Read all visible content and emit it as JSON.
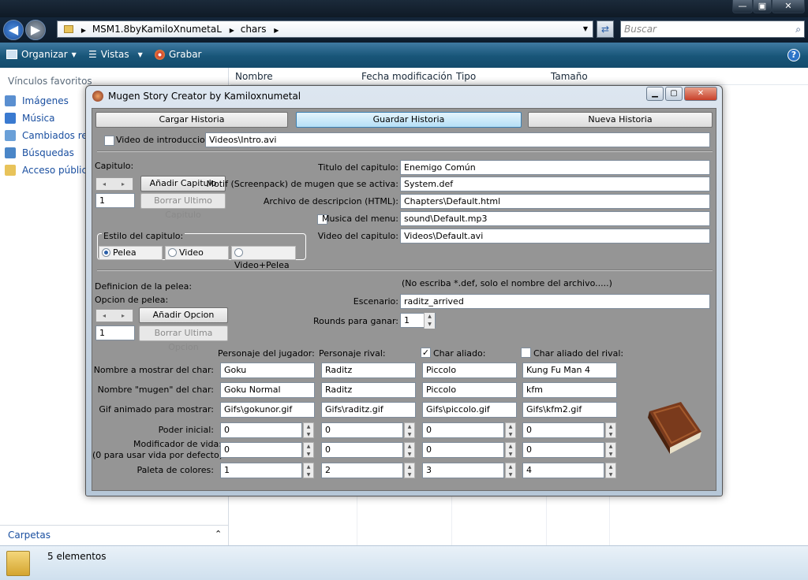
{
  "explorer": {
    "window_buttons": {
      "minimize": "—",
      "maximize": "▣",
      "close": "✕"
    },
    "nav": {
      "back": "◀",
      "forward": "▶"
    },
    "breadcrumb": [
      "MSM1.8byKamiloXnumetaL",
      "chars"
    ],
    "search_placeholder": "Buscar",
    "toolbar": {
      "organize": "Organizar",
      "views": "Vistas",
      "record": "Grabar"
    },
    "favorites_title": "Vínculos favoritos",
    "favorites": [
      "Imágenes",
      "Música",
      "Cambiados rec",
      "Búsquedas",
      "Acceso públic"
    ],
    "folders_label": "Carpetas",
    "columns": [
      "Nombre",
      "Fecha modificación",
      "Tipo",
      "Tamaño"
    ],
    "status": "5 elementos"
  },
  "dialog": {
    "title": "Mugen Story Creator by Kamiloxnumetal",
    "buttons": {
      "load": "Cargar Historia",
      "save": "Guardar Historia",
      "new": "Nueva Historia"
    },
    "intro_video": {
      "label": "Video de introduccion:",
      "value": "Videos\\Intro.avi",
      "checked": false
    },
    "chapter": {
      "label": "Capitulo:",
      "add": "Añadir Capitulo",
      "remove_last": "Borrar Ultimo Capitulo",
      "number": "1",
      "style_title": "Estilo del capitulo:",
      "style_options": [
        "Pelea",
        "Video",
        "Video+Pelea"
      ],
      "style_selected": 0
    },
    "chapter_fields": {
      "title_label": "Titulo del capitulo:",
      "title_value": "Enemigo Común",
      "motif_label": "Motif (Screenpack) de mugen que se activa:",
      "motif_value": "System.def",
      "desc_label": "Archivo de descripcion (HTML):",
      "desc_value": "Chapters\\Default.html",
      "music_label": "Musica del menu:",
      "music_value": "sound\\Default.mp3",
      "video_label": "Video del capitulo:",
      "video_value": "Videos\\Default.avi"
    },
    "fight": {
      "definition_label": "Definicion de la pelea:",
      "option_label": "Opcion de pelea:",
      "add": "Añadir Opcion",
      "remove_last": "Borrar Ultima Opcion",
      "number": "1",
      "hint": "(No escriba *.def, solo el nombre del archivo.....)",
      "stage_label": "Escenario:",
      "stage_value": "raditz_arrived",
      "rounds_label": "Rounds para ganar:",
      "rounds_value": "1"
    },
    "grid": {
      "columns": [
        {
          "header": "Personaje del jugador:",
          "name": "Goku",
          "mugen": "Goku Normal",
          "gif": "Gifs\\gokunor.gif",
          "power": "0",
          "life": "0",
          "palette": "1"
        },
        {
          "header": "Personaje rival:",
          "name": "Raditz",
          "mugen": "Raditz",
          "gif": "Gifs\\raditz.gif",
          "power": "0",
          "life": "0",
          "palette": "2"
        },
        {
          "header": "Char aliado:",
          "name": "Piccolo",
          "mugen": "Piccolo",
          "gif": "Gifs\\piccolo.gif",
          "power": "0",
          "life": "0",
          "palette": "3",
          "checked": true
        },
        {
          "header": "Char aliado del rival:",
          "name": "Kung Fu Man 4",
          "mugen": "kfm",
          "gif": "Gifs\\kfm2.gif",
          "power": "0",
          "life": "0",
          "palette": "4",
          "checked": false
        }
      ],
      "row_labels": {
        "name": "Nombre a mostrar del char:",
        "mugen": "Nombre \"mugen\" del char:",
        "gif": "Gif animado para mostrar:",
        "power": "Poder inicial:",
        "life1": "Modificador de vida:",
        "life2": "(0 para usar vida por defecto)",
        "palette": "Paleta de colores:"
      }
    }
  }
}
